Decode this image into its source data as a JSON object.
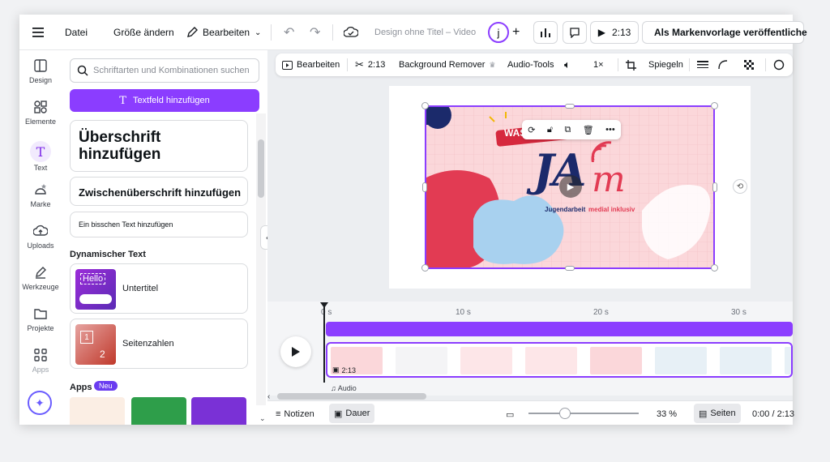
{
  "topbar": {
    "menu_icon": "hamburger-icon",
    "file": "Datei",
    "resize": "Größe ändern",
    "edit": "Bearbeiten",
    "doc_title": "Design ohne Titel – Video",
    "avatar_letter": "j",
    "duration": "2:13",
    "brand_template": "Als Markenvorlage veröffentliche"
  },
  "rail": {
    "items": [
      {
        "label": "Design",
        "icon": "layout-icon"
      },
      {
        "label": "Elemente",
        "icon": "shapes-icon"
      },
      {
        "label": "Text",
        "icon": "text-icon"
      },
      {
        "label": "Marke",
        "icon": "brand-icon"
      },
      {
        "label": "Uploads",
        "icon": "upload-cloud-icon"
      },
      {
        "label": "Werkzeuge",
        "icon": "pen-icon"
      },
      {
        "label": "Projekte",
        "icon": "folder-icon"
      },
      {
        "label": "Apps",
        "icon": "apps-grid-icon"
      }
    ]
  },
  "panel": {
    "search_placeholder": "Schriftarten und Kombinationen suchen",
    "add_textbox": "Textfeld hinzufügen",
    "heading": "Überschrift hinzufügen",
    "subheading": "Zwischenüberschrift hinzufügen",
    "body_text": "Ein bisschen Text hinzufügen",
    "dynamic_title": "Dynamischer Text",
    "subtitle_label": "Untertitel",
    "subtitle_thumb": "Hello",
    "page_numbers_label": "Seitenzahlen",
    "apps_title": "Apps",
    "apps_badge": "Neu"
  },
  "toolbar2": {
    "edit": "Bearbeiten",
    "cut_time": "2:13",
    "bg_remover": "Background Remover",
    "audio_tools": "Audio-Tools",
    "speed": "1×",
    "mirror": "Spiegeln"
  },
  "design": {
    "banner": "WAS",
    "logo_main": "JA",
    "logo_m": "m",
    "tagline_a": "Jugendarbeit",
    "tagline_b": "medial inklusiv"
  },
  "timeline": {
    "ticks": [
      "0 s",
      "10 s",
      "20 s",
      "30 s"
    ],
    "clip_duration": "2:13",
    "audio_label": "Audio"
  },
  "bottombar": {
    "notes": "Notizen",
    "duration": "Dauer",
    "zoom": "33 %",
    "pages": "Seiten",
    "time": "0:00 / 2:13"
  },
  "colors": {
    "accent": "#8b3dff",
    "navy": "#1b2a6b",
    "red": "#e23b53",
    "pink_bg": "#fbd7da"
  }
}
